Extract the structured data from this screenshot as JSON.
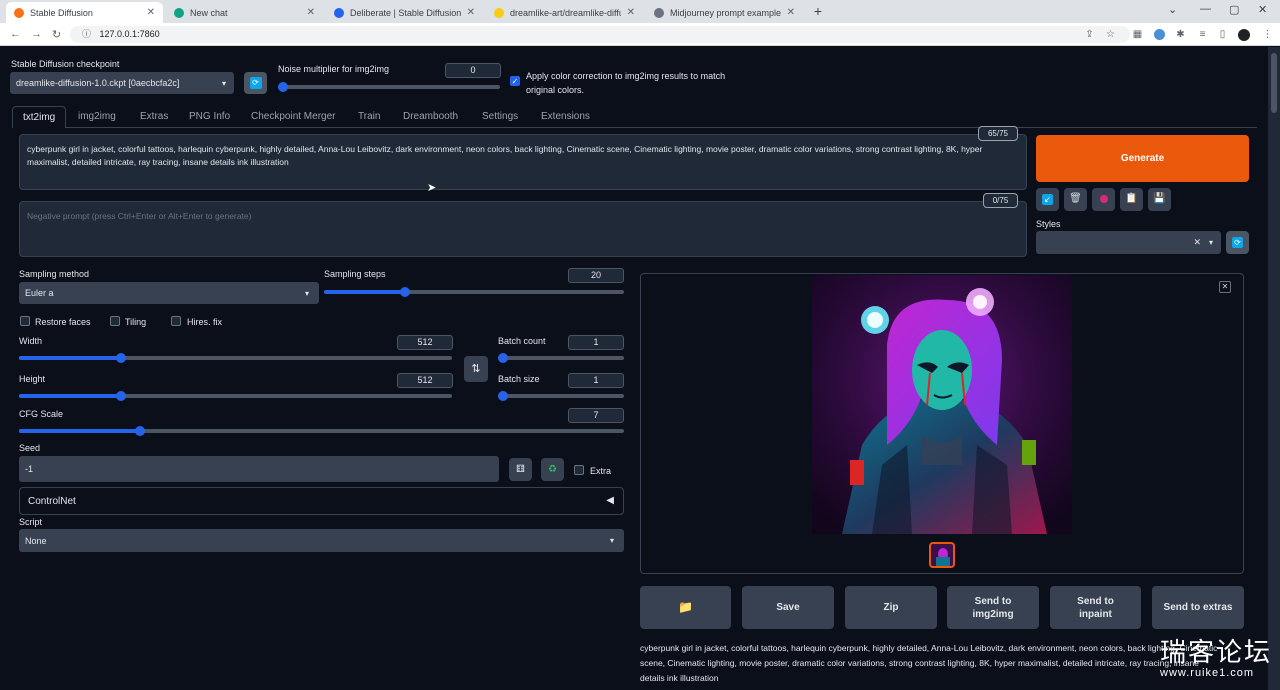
{
  "browser": {
    "tabs": [
      {
        "title": "Stable Diffusion",
        "color": "#f97316",
        "active": true
      },
      {
        "title": "New chat",
        "color": "#10a37f",
        "active": false
      },
      {
        "title": "Deliberate | Stable Diffusion Che",
        "color": "#2563eb",
        "active": false
      },
      {
        "title": "dreamlike-art/dreamlike-diffusio",
        "color": "#facc15",
        "active": false
      },
      {
        "title": "Midjourney prompt examples : Li",
        "color": "#6b7280",
        "active": false
      }
    ],
    "url": "127.0.0.1:7860"
  },
  "top": {
    "checkpoint_label": "Stable Diffusion checkpoint",
    "checkpoint_value": "dreamlike-diffusion-1.0.ckpt [0aecbcfa2c]",
    "noise_label": "Noise multiplier for img2img",
    "noise_value": "0",
    "noise_level": 0,
    "color_correction_line1": "Apply color correction to img2img results to match",
    "color_correction_line2": "original colors."
  },
  "tabs": [
    "txt2img",
    "img2img",
    "Extras",
    "PNG Info",
    "Checkpoint Merger",
    "Train",
    "Dreambooth",
    "Settings",
    "Extensions"
  ],
  "prompt": {
    "text_line1": "cyberpunk girl in jacket, colorful tattoos, harlequin cyberpunk, highly detailed, Anna-Lou Leibovitz, dark environment, neon colors, back lighting, Cinematic scene, Cinematic lighting, movie poster, dramatic color variations, strong contrast lighting, 8K, hyper",
    "text_line2": "maximalist, detailed intricate, ray tracing, insane details ink illustration",
    "counter": "65/75",
    "negative_placeholder": "Negative prompt (press Ctrl+Enter or Alt+Enter to generate)",
    "negative_counter": "0/75"
  },
  "generate_label": "Generate",
  "styles_label": "Styles",
  "sampling": {
    "method_label": "Sampling method",
    "method_value": "Euler a",
    "steps_label": "Sampling steps",
    "steps_value": "20",
    "steps_level": 0.27
  },
  "options": {
    "restore_faces": "Restore faces",
    "tiling": "Tiling",
    "hires_fix": "Hires. fix"
  },
  "size": {
    "width_label": "Width",
    "width_value": "512",
    "width_level": 0.235,
    "height_label": "Height",
    "height_value": "512",
    "height_level": 0.235,
    "batch_count_label": "Batch count",
    "batch_count_value": "1",
    "batch_count_level": 0,
    "batch_size_label": "Batch size",
    "batch_size_value": "1",
    "batch_size_level": 0
  },
  "cfg": {
    "label": "CFG Scale",
    "value": "7",
    "level": 0.2
  },
  "seed": {
    "label": "Seed",
    "value": "-1",
    "extra_label": "Extra"
  },
  "controlnet_label": "ControlNet",
  "script": {
    "label": "Script",
    "value": "None"
  },
  "output_buttons": {
    "save": "Save",
    "zip": "Zip",
    "send_img2img": "Send to img2img",
    "send_inpaint": "Send to inpaint",
    "send_extras": "Send to extras"
  },
  "caption": {
    "line1": "cyberpunk girl in jacket, colorful tattoos, harlequin cyberpunk, highly detailed, Anna-Lou Leibovitz, dark environment, neon colors, back lighting, Cinematic",
    "line2": "scene, Cinematic lighting, movie poster, dramatic color variations, strong contrast lighting, 8K, hyper maximalist, detailed intricate, ray tracing, insane",
    "line3": "details ink illustration"
  },
  "watermark": {
    "big": "瑞客论坛",
    "small": "www.ruike1.com"
  },
  "colors": {
    "accent": "#2563eb",
    "generate": "#ea580c",
    "bg": "#0b0f19",
    "panel": "#1f2937"
  }
}
